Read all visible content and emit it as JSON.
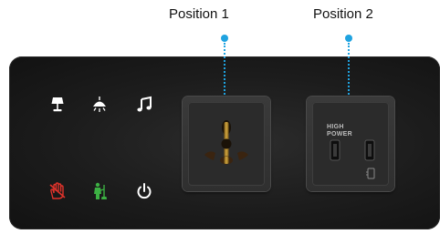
{
  "labels": {
    "position_1": "Position 1",
    "position_2": "Position 2"
  },
  "usb_module": {
    "high_text": "HIGH",
    "power_text": "POWER"
  },
  "icons": {
    "lamp": "lamp-icon",
    "ceiling_light": "ceiling-light-icon",
    "music": "music-icon",
    "do_not_disturb": "do-not-disturb-icon",
    "housekeeping": "housekeeping-icon",
    "power": "power-icon"
  },
  "colors": {
    "pointer": "#1fa3e0",
    "icon_default": "#ffffff",
    "do_not_disturb": "#e0332b",
    "housekeeping": "#3cb043",
    "socket_brass": "#b58a2c"
  }
}
